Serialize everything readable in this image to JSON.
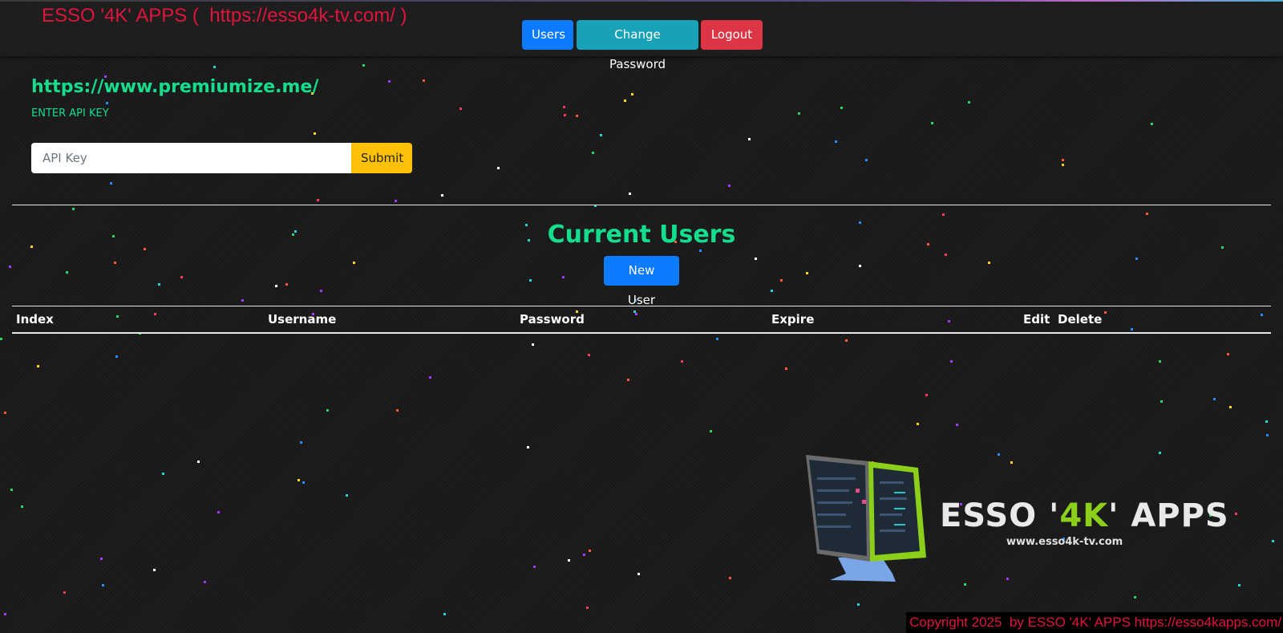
{
  "header": {
    "brand": "ESSO '4K' APPS (  https://esso4k-tv.com/ )",
    "nav": {
      "users": "Users",
      "change_password": "Change Password",
      "logout": "Logout"
    }
  },
  "api": {
    "site_url": "https://www.premiumize.me/",
    "label": "ENTER API KEY",
    "input_placeholder": "API Key",
    "input_value": "",
    "submit": "Submit"
  },
  "users_section": {
    "title": "Current Users",
    "new_user": "New User",
    "columns": {
      "index": "Index",
      "username": "Username",
      "password": "Password",
      "expire": "Expire",
      "edit": "Edit",
      "delete": "Delete"
    },
    "rows": []
  },
  "logo": {
    "text_prefix": "ESSO '",
    "text_accent": "4K",
    "text_suffix": "' APPS",
    "url": "www.esso4k-tv.com"
  },
  "footer": {
    "copyright": "Copyright 2025  by ESSO '4K' APPS https://esso4kapps.com/"
  },
  "colors": {
    "accent_green": "#14dd8e",
    "brand_red": "#e0143c",
    "primary_blue": "#0d7bff",
    "info_teal": "#17a2b8",
    "danger_red": "#dc3545",
    "warning_yellow": "#ffc107",
    "logo_lime": "#8ccf1a"
  }
}
